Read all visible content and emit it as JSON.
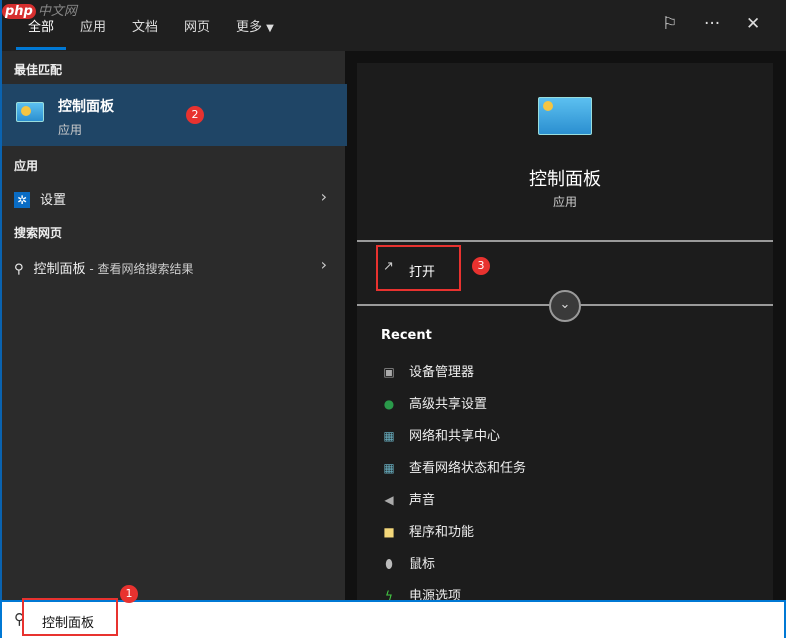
{
  "watermark": {
    "logo_text": "php",
    "site_text": "中文网"
  },
  "tabs": [
    {
      "label": "全部"
    },
    {
      "label": "应用"
    },
    {
      "label": "文档"
    },
    {
      "label": "网页"
    },
    {
      "label": "更多"
    }
  ],
  "top_icons": [
    "feedback-icon",
    "more-icon",
    "close-icon"
  ],
  "left": {
    "best_match_header": "最佳匹配",
    "best_match": {
      "title": "控制面板",
      "subtitle": "应用",
      "badge": "2"
    },
    "apps_header": "应用",
    "apps": [
      {
        "label": "设置"
      }
    ],
    "web_header": "搜索网页",
    "web": {
      "label": "控制面板",
      "suffix": " - 查看网络搜索结果"
    }
  },
  "right": {
    "title": "控制面板",
    "subtitle": "应用",
    "open_label": "打开",
    "open_badge": "3",
    "recent_header": "Recent",
    "recent": [
      {
        "label": "设备管理器",
        "icon": "device-manager-icon"
      },
      {
        "label": "高级共享设置",
        "icon": "sharing-icon"
      },
      {
        "label": "网络和共享中心",
        "icon": "network-icon"
      },
      {
        "label": "查看网络状态和任务",
        "icon": "network-icon"
      },
      {
        "label": "声音",
        "icon": "speaker-icon"
      },
      {
        "label": "程序和功能",
        "icon": "programs-icon"
      },
      {
        "label": "鼠标",
        "icon": "mouse-icon"
      },
      {
        "label": "电源选项",
        "icon": "power-icon"
      }
    ]
  },
  "search": {
    "value": "控制面板",
    "badge": "1"
  },
  "colors": {
    "accent": "#0078d4",
    "selected": "#1f4566",
    "badge": "#e8322f"
  }
}
